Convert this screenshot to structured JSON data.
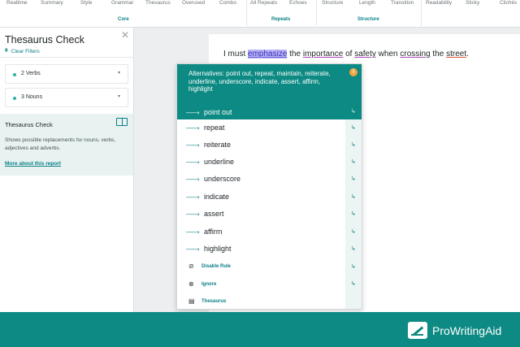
{
  "toolbar": {
    "tools": [
      "Realtime",
      "Summary",
      "Style",
      "Grammar",
      "Thesaurus",
      "Overused",
      "Combo",
      "All Repeats",
      "Echoes",
      "Structure",
      "Length",
      "Transition",
      "Readability",
      "Sticky",
      "Clichés"
    ],
    "groups": [
      "Core",
      "Repeats",
      "Structure"
    ]
  },
  "sidebar": {
    "title": "Thesaurus Check",
    "clear_filters": "Clear Filters",
    "categories": [
      {
        "label": "2 Verbs",
        "dot_color": "#28b3a0"
      },
      {
        "label": "3 Nouns",
        "dot_color": "#28b3a0"
      }
    ],
    "info": {
      "title": "Thesaurus Check",
      "description": "Shows possible replacements for nouns, verbs, adjectives and adverbs.",
      "link": "More about this report"
    }
  },
  "document": {
    "sentence": {
      "w0": "I must ",
      "w1": "emphasize",
      "w2": " the ",
      "w3": "importance",
      "w4": " of ",
      "w5": "safety",
      "w6": " when ",
      "w7": "crossing",
      "w8": " the ",
      "w9": "street",
      "w10": "."
    }
  },
  "popup": {
    "header": "Alternatives: point out, repeat, maintain, reiterate, underline, underscore, indicate, assert, affirm, highlight",
    "info_badge": "i",
    "options": [
      "point out",
      "repeat",
      "reiterate",
      "underline",
      "underscore",
      "indicate",
      "assert",
      "affirm",
      "highlight"
    ],
    "actions": [
      "Disable Rule",
      "Ignore",
      "Thesaurus"
    ]
  },
  "footer": {
    "brand": "ProWritingAid"
  },
  "colors": {
    "accent": "#0d8a83",
    "highlight": "#b8b3f4"
  }
}
